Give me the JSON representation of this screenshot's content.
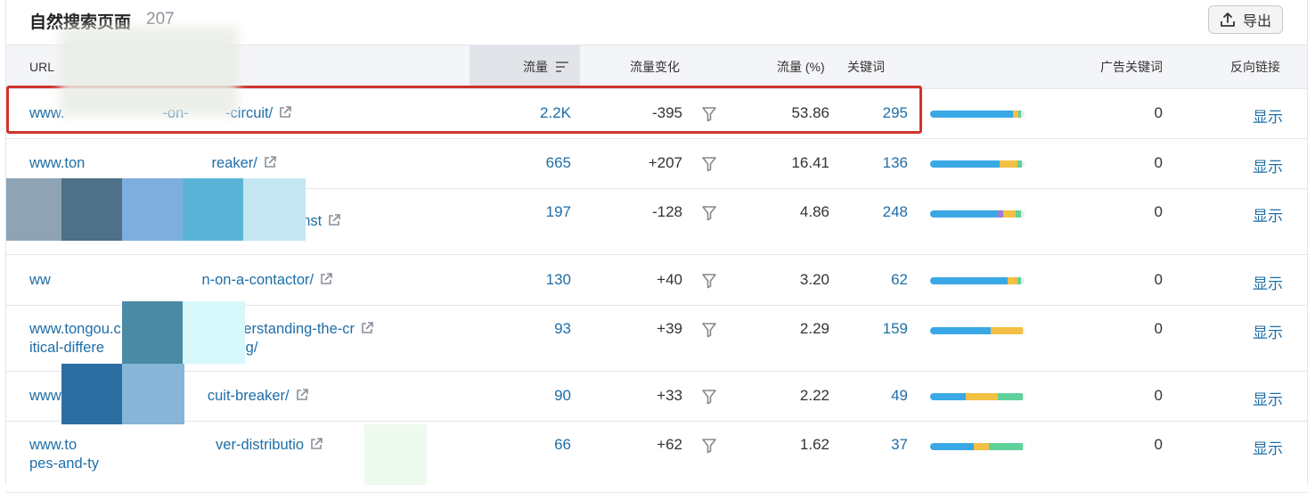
{
  "header": {
    "title": "自然搜索页面",
    "count": "207",
    "export_label": "导出"
  },
  "columns": {
    "url": "URL",
    "traffic": "流量",
    "traffic_change": "流量变化",
    "traffic_pct": "流量 (%)",
    "keywords": "关键词",
    "ad_keywords": "广告关键词",
    "backlinks": "反向链接"
  },
  "colors": {
    "link": "#1e6ea7",
    "highlight": "#d0342c",
    "seg_blue": "#3ba8e6",
    "seg_yellow": "#f2c042",
    "seg_green": "#5fd19a",
    "seg_purple": "#9b7fd4"
  },
  "rows": [
    {
      "url_line1": "www.                        -on-         -circuit/",
      "url_line2": "",
      "traffic": "2.2K",
      "change": "-395",
      "pct": "53.86",
      "keywords": "295",
      "ads": "0",
      "backlinks": "显示",
      "dist": [
        {
          "c": "seg_blue",
          "v": 0.88
        },
        {
          "c": "seg_yellow",
          "v": 0.05
        },
        {
          "c": "seg_green",
          "v": 0.03
        }
      ]
    },
    {
      "url_line1": "www.ton                               reaker/",
      "url_line2": "",
      "traffic": "665",
      "change": "+207",
      "pct": "16.41",
      "keywords": "136",
      "ads": "0",
      "backlinks": "显示",
      "dist": [
        {
          "c": "seg_blue",
          "v": 0.74
        },
        {
          "c": "seg_yellow",
          "v": 0.18
        },
        {
          "c": "seg_green",
          "v": 0.05
        }
      ]
    },
    {
      "url_line1": "                                  we-use-ac-in-home-inst",
      "url_line2": "",
      "traffic": "197",
      "change": "-128",
      "pct": "4.86",
      "keywords": "248",
      "ads": "0",
      "backlinks": "显示",
      "dist": [
        {
          "c": "seg_blue",
          "v": 0.72
        },
        {
          "c": "seg_purple",
          "v": 0.05
        },
        {
          "c": "seg_yellow",
          "v": 0.14
        },
        {
          "c": "seg_green",
          "v": 0.05
        }
      ]
    },
    {
      "url_line1": "ww                                     n-on-a-contactor/",
      "url_line2": "",
      "traffic": "130",
      "change": "+40",
      "pct": "3.20",
      "keywords": "62",
      "ads": "0",
      "backlinks": "显示",
      "dist": [
        {
          "c": "seg_blue",
          "v": 0.82
        },
        {
          "c": "seg_yellow",
          "v": 0.1
        },
        {
          "c": "seg_green",
          "v": 0.04
        }
      ]
    },
    {
      "url_line1": "www.tongou.c                        understanding-the-cr",
      "url_line2": "itical-differe                          -wiring/",
      "traffic": "93",
      "change": "+39",
      "pct": "2.29",
      "keywords": "159",
      "ads": "0",
      "backlinks": "显示",
      "dist": [
        {
          "c": "seg_blue",
          "v": 0.64
        },
        {
          "c": "seg_yellow",
          "v": 0.34
        }
      ]
    },
    {
      "url_line1": "www.t                                  cuit-breaker/",
      "url_line2": "",
      "traffic": "90",
      "change": "+33",
      "pct": "2.22",
      "keywords": "49",
      "ads": "0",
      "backlinks": "显示",
      "dist": [
        {
          "c": "seg_blue",
          "v": 0.38
        },
        {
          "c": "seg_yellow",
          "v": 0.34
        },
        {
          "c": "seg_green",
          "v": 0.26
        }
      ]
    },
    {
      "url_line1": "www.to                                  ver-distributio",
      "url_line2": "pes-and-ty",
      "traffic": "66",
      "change": "+62",
      "pct": "1.62",
      "keywords": "37",
      "ads": "0",
      "backlinks": "显示",
      "dist": [
        {
          "c": "seg_blue",
          "v": 0.46
        },
        {
          "c": "seg_yellow",
          "v": 0.16
        },
        {
          "c": "seg_green",
          "v": 0.36
        }
      ]
    }
  ]
}
